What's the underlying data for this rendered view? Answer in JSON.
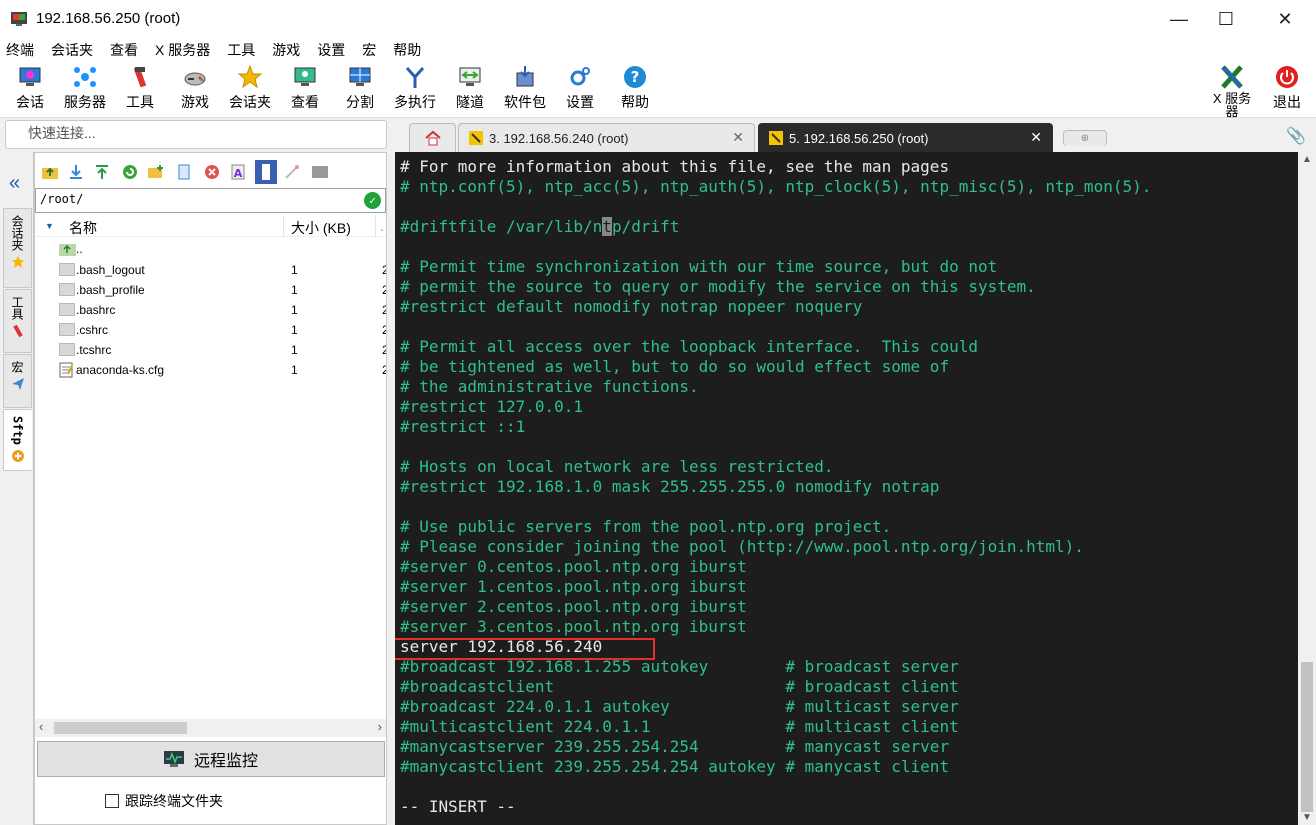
{
  "window": {
    "title": "192.168.56.250 (root)",
    "minimize": "—",
    "maximize": "☐",
    "close": "✕"
  },
  "menu": [
    "终端",
    "会话夹",
    "查看",
    "X 服务器",
    "工具",
    "游戏",
    "设置",
    "宏",
    "帮助"
  ],
  "toolbar": {
    "buttons": [
      {
        "label": "会话",
        "icon": "session-icon"
      },
      {
        "label": "服务器",
        "icon": "servers-icon"
      },
      {
        "label": "工具",
        "icon": "tools-icon"
      },
      {
        "label": "游戏",
        "icon": "games-icon"
      },
      {
        "label": "会话夹",
        "icon": "star-icon"
      },
      {
        "label": "查看",
        "icon": "view-icon"
      },
      {
        "label": "分割",
        "icon": "split-icon"
      },
      {
        "label": "多执行",
        "icon": "multiexec-icon"
      },
      {
        "label": "隧道",
        "icon": "tunnel-icon"
      },
      {
        "label": "软件包",
        "icon": "packages-icon"
      },
      {
        "label": "设置",
        "icon": "settings-icon"
      },
      {
        "label": "帮助",
        "icon": "help-icon"
      }
    ],
    "xserver_label": "X 服务器",
    "exit_label": "退出"
  },
  "quick_connect": {
    "placeholder": "快速连接..."
  },
  "tabs": [
    {
      "label": "3. 192.168.56.240 (root)",
      "active": false
    },
    {
      "label": "5. 192.168.56.250 (root)",
      "active": true
    }
  ],
  "side_tabs": [
    "会话夹",
    "工具",
    "宏",
    "Sftp"
  ],
  "sftp": {
    "path": "/root/",
    "columns": {
      "name": "名称",
      "size": "大小 (KB)"
    },
    "files": [
      {
        "name": "..",
        "size": "",
        "date": ""
      },
      {
        "name": ".bash_logout",
        "size": "1",
        "date": "2"
      },
      {
        "name": ".bash_profile",
        "size": "1",
        "date": "2"
      },
      {
        "name": ".bashrc",
        "size": "1",
        "date": "2"
      },
      {
        "name": ".cshrc",
        "size": "1",
        "date": "2"
      },
      {
        "name": ".tcshrc",
        "size": "1",
        "date": "2"
      },
      {
        "name": "anaconda-ks.cfg",
        "size": "1",
        "date": "2"
      }
    ],
    "monitor_button": "远程监控",
    "follow_label": "跟踪终端文件夹"
  },
  "terminal": {
    "lines": [
      {
        "text": "# For more information about this file, see the man pages",
        "white": true
      },
      {
        "text": "# ntp.conf(5), ntp_acc(5), ntp_auth(5), ntp_clock(5), ntp_misc(5), ntp_mon(5).",
        "white": false
      },
      {
        "text": "",
        "white": false
      },
      {
        "text": "#driftfile /var/lib/ntp/drift",
        "white": false
      },
      {
        "text": "",
        "white": false
      },
      {
        "text": "# Permit time synchronization with our time source, but do not",
        "white": false
      },
      {
        "text": "# permit the source to query or modify the service on this system.",
        "white": false
      },
      {
        "text": "#restrict default nomodify notrap nopeer noquery",
        "white": false
      },
      {
        "text": "",
        "white": false
      },
      {
        "text": "# Permit all access over the loopback interface.  This could",
        "white": false
      },
      {
        "text": "# be tightened as well, but to do so would effect some of",
        "white": false
      },
      {
        "text": "# the administrative functions.",
        "white": false
      },
      {
        "text": "#restrict 127.0.0.1",
        "white": false
      },
      {
        "text": "#restrict ::1",
        "white": false
      },
      {
        "text": "",
        "white": false
      },
      {
        "text": "# Hosts on local network are less restricted.",
        "white": false
      },
      {
        "text": "#restrict 192.168.1.0 mask 255.255.255.0 nomodify notrap",
        "white": false
      },
      {
        "text": "",
        "white": false
      },
      {
        "text": "# Use public servers from the pool.ntp.org project.",
        "white": false
      },
      {
        "text": "# Please consider joining the pool (http://www.pool.ntp.org/join.html).",
        "white": false
      },
      {
        "text": "#server 0.centos.pool.ntp.org iburst",
        "white": false
      },
      {
        "text": "#server 1.centos.pool.ntp.org iburst",
        "white": false
      },
      {
        "text": "#server 2.centos.pool.ntp.org iburst",
        "white": false
      },
      {
        "text": "#server 3.centos.pool.ntp.org iburst",
        "white": false
      },
      {
        "text": "server 192.168.56.240",
        "white": true
      },
      {
        "text": "#broadcast 192.168.1.255 autokey        # broadcast server",
        "white": false
      },
      {
        "text": "#broadcastclient                        # broadcast client",
        "white": false
      },
      {
        "text": "#broadcast 224.0.1.1 autokey            # multicast server",
        "white": false
      },
      {
        "text": "#multicastclient 224.0.1.1              # multicast client",
        "white": false
      },
      {
        "text": "#manycastserver 239.255.254.254         # manycast server",
        "white": false
      },
      {
        "text": "#manycastclient 239.255.254.254 autokey # manycast client",
        "white": false
      },
      {
        "text": "",
        "white": false
      },
      {
        "text": "-- INSERT --",
        "white": true
      }
    ],
    "driftfile_parts": [
      "#driftfile /var/lib/n",
      "t",
      "p/drift"
    ]
  },
  "colors": {
    "terminal_bg": "#1d1d1d",
    "comment_green": "#2fbf8f",
    "text_white": "#e8e8e8",
    "highlight_red": "#e03030",
    "active_tab": "#2b2b2b"
  }
}
